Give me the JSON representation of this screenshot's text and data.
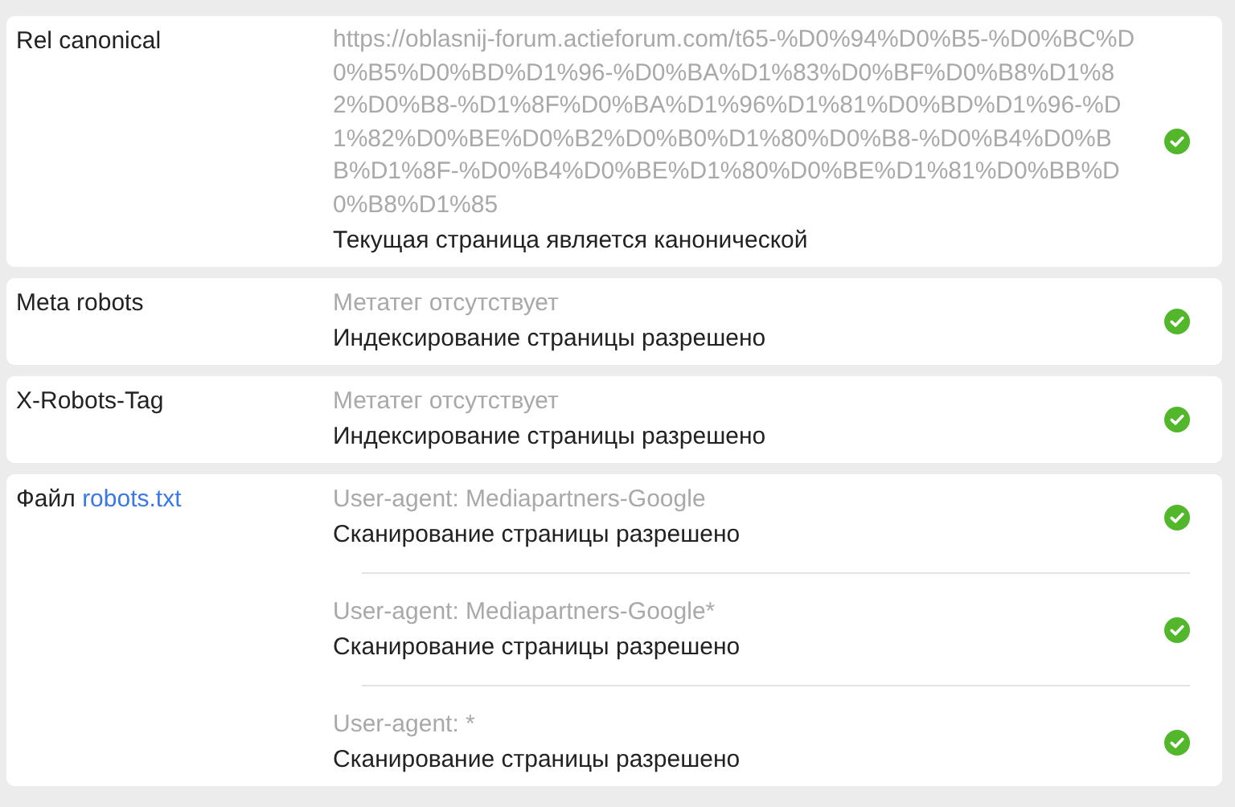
{
  "rows": [
    {
      "label": "Rel canonical",
      "entries": [
        {
          "detail": "https://oblasnij-forum.actieforum.com/t65-%D0%94%D0%B5-%D0%BC%D0%B5%D0%BD%D1%96-%D0%BA%D1%83%D0%BF%D0%B8%D1%82%D0%B8-%D1%8F%D0%BA%D1%96%D1%81%D0%BD%D1%96-%D1%82%D0%BE%D0%B2%D0%B0%D1%80%D0%B8-%D0%B4%D0%BB%D1%8F-%D0%B4%D0%BE%D1%80%D0%BE%D1%81%D0%BB%D0%B8%D1%85",
          "kind": "url",
          "result": "Текущая страница является канонической",
          "passed": true
        }
      ]
    },
    {
      "label": "Meta robots",
      "entries": [
        {
          "detail": "Метатег отсутствует",
          "result": "Индексирование страницы разрешено",
          "passed": true
        }
      ]
    },
    {
      "label": "X-Robots-Tag",
      "entries": [
        {
          "detail": "Метатег отсутствует",
          "result": "Индексирование страницы разрешено",
          "passed": true
        }
      ]
    },
    {
      "label": "Файл",
      "link": "robots.txt",
      "entries": [
        {
          "detail": "User-agent: Mediapartners-Google",
          "result": "Сканирование страницы разрешено",
          "passed": true
        },
        {
          "detail": "User-agent: Mediapartners-Google*",
          "result": "Сканирование страницы разрешено",
          "passed": true
        },
        {
          "detail": "User-agent: *",
          "result": "Сканирование страницы разрешено",
          "passed": true
        }
      ]
    }
  ]
}
